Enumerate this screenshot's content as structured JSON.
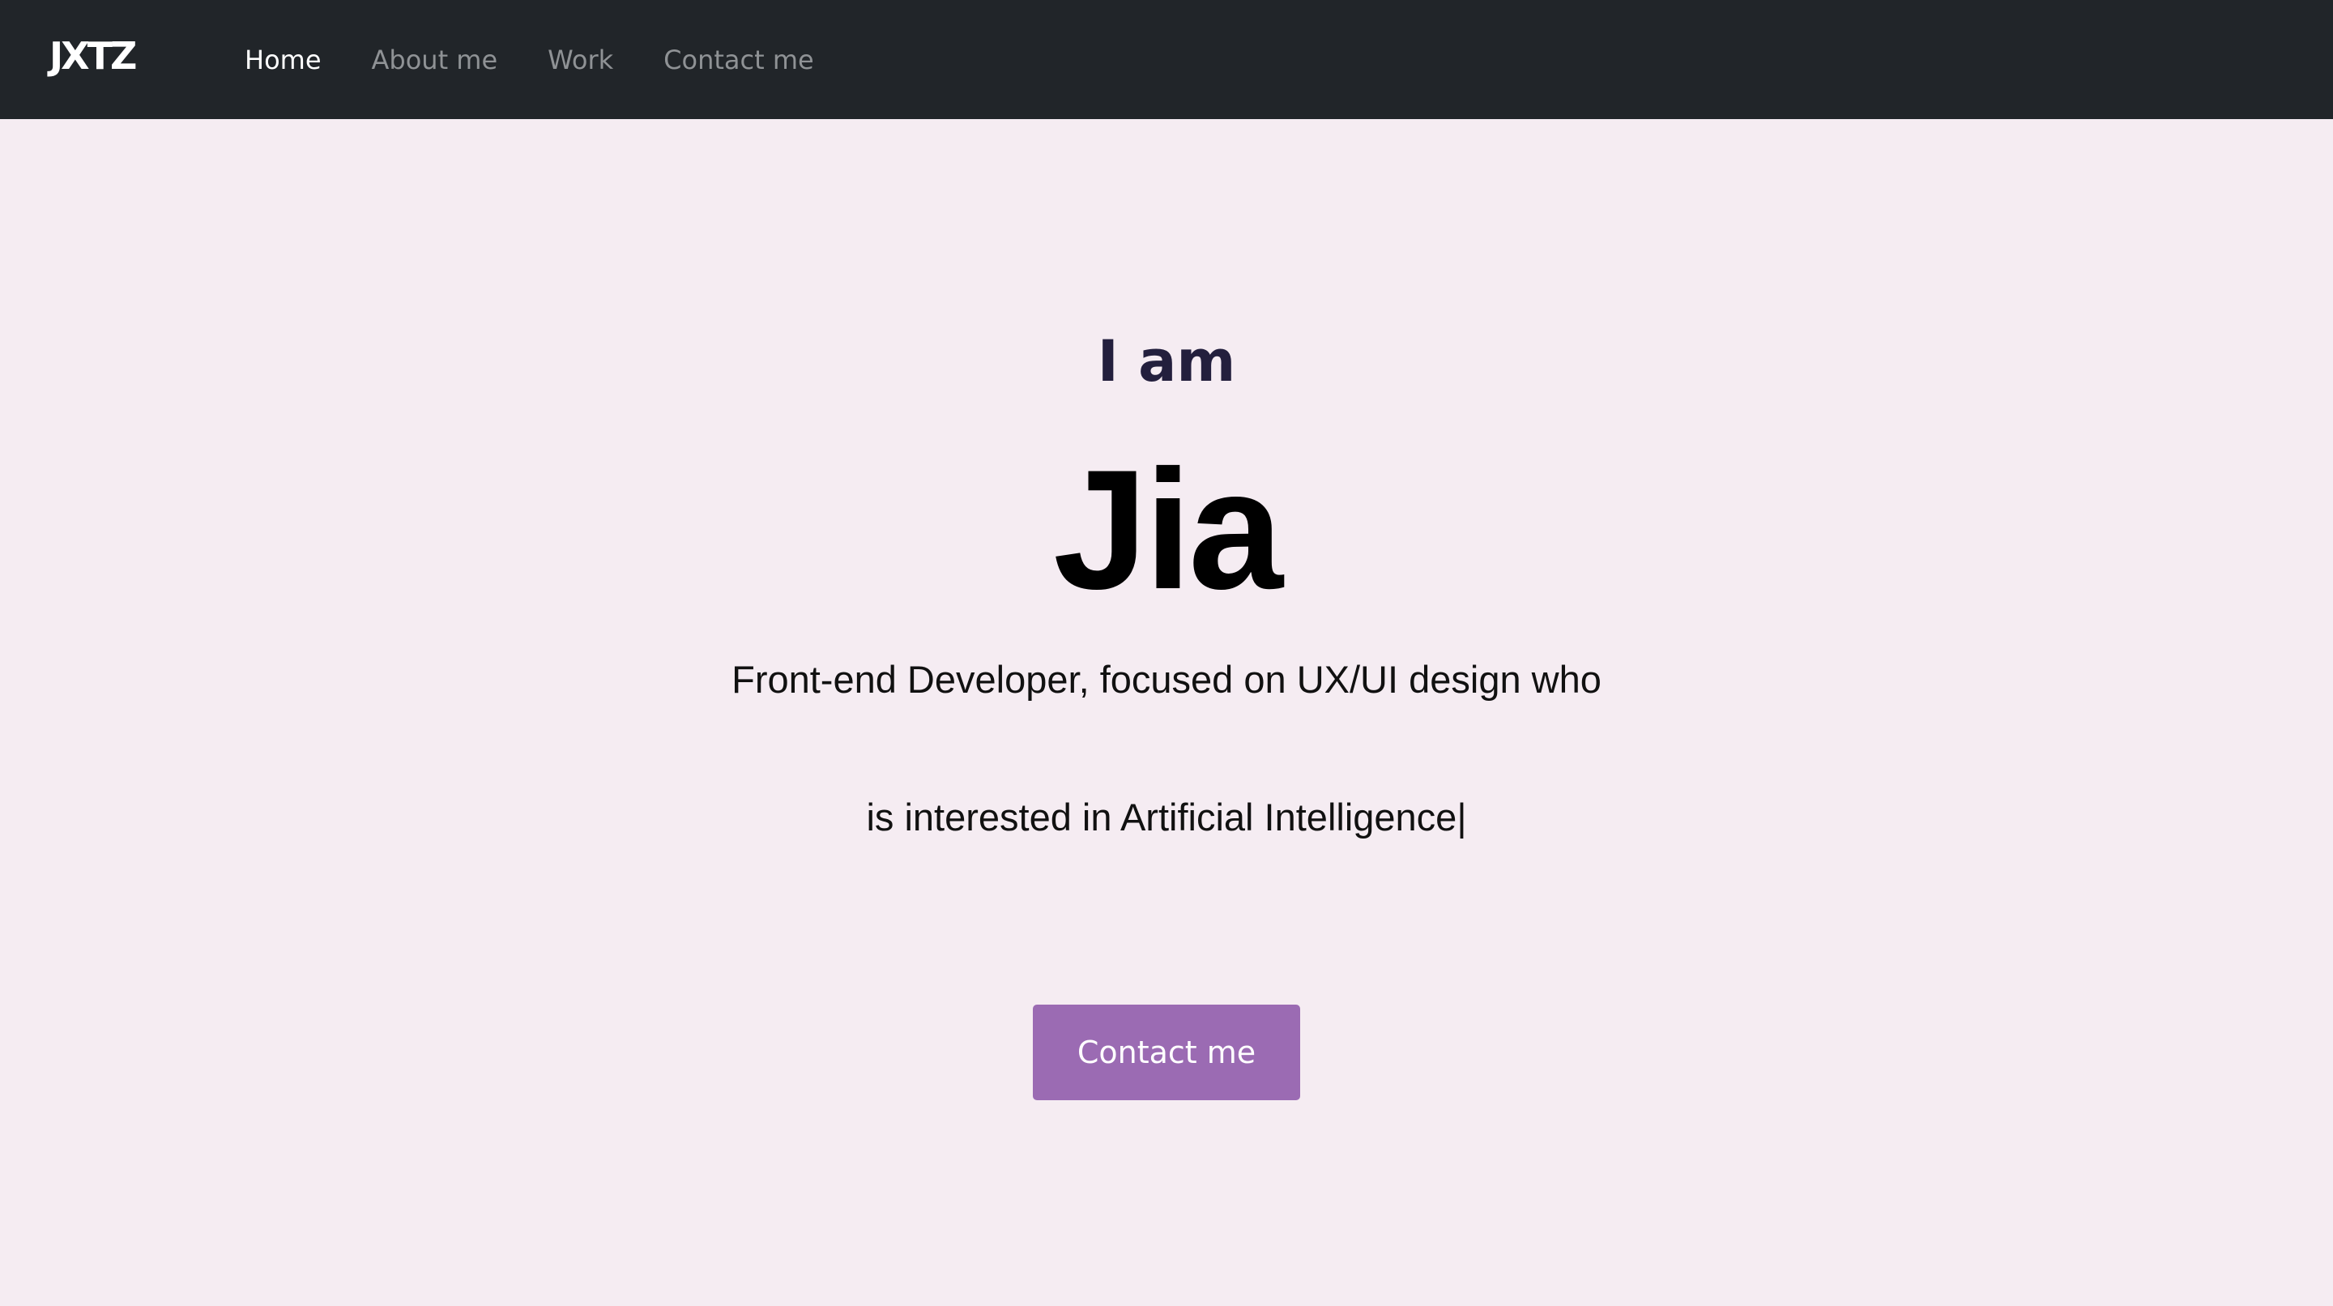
{
  "nav": {
    "brand": "JXTZ",
    "links": [
      {
        "label": "Home",
        "active": true
      },
      {
        "label": "About me",
        "active": false
      },
      {
        "label": "Work",
        "active": false
      },
      {
        "label": "Contact me",
        "active": false
      }
    ]
  },
  "hero": {
    "intro": "I am",
    "name": "Jia",
    "tagline_line1": "Front-end Developer, focused on UX/UI design who",
    "tagline_line2": "is interested in Artificial Intelligence|",
    "cta_label": "Contact me"
  },
  "colors": {
    "nav_background": "#212529",
    "page_background": "#f5ecf2",
    "button": "#9b6bb3",
    "intro_text": "#231f3d"
  }
}
